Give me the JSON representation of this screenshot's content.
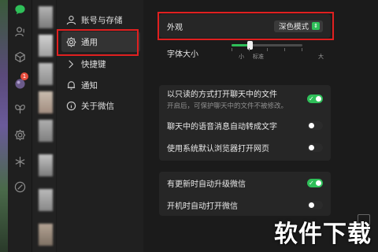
{
  "rail": {
    "badge": "1",
    "icons": [
      "chat-icon",
      "contacts-icon",
      "box-icon",
      "photo-icon",
      "butterfly-icon",
      "settings-gear-icon",
      "sparkle-icon",
      "link-icon"
    ]
  },
  "sidebar": {
    "items": [
      {
        "label": "账号与存储",
        "icon": "user-icon"
      },
      {
        "label": "通用",
        "icon": "gear-icon"
      },
      {
        "label": "快捷键",
        "icon": "keyboard-icon"
      },
      {
        "label": "通知",
        "icon": "bell-icon"
      },
      {
        "label": "关于微信",
        "icon": "info-icon"
      }
    ]
  },
  "main": {
    "appearance": {
      "label": "外观",
      "value": "深色模式"
    },
    "font_size": {
      "label": "字体大小",
      "marks": [
        "小",
        "标准",
        "大"
      ],
      "level": 0.25
    },
    "group1": [
      {
        "title": "以只读的方式打开聊天中的文件",
        "sub": "开启后，可保护聊天中的文件不被修改。",
        "on": true
      },
      {
        "title": "聊天中的语音消息自动转成文字",
        "sub": "",
        "on": false
      },
      {
        "title": "使用系统默认浏览器打开网页",
        "sub": "",
        "on": false
      }
    ],
    "group2": [
      {
        "title": "有更新时自动升级微信",
        "on": true
      },
      {
        "title": "开机时自动打开微信",
        "on": false
      }
    ]
  },
  "watermark": "软件下载",
  "colors": {
    "accent": "#2fbf59",
    "highlight": "#e02020"
  }
}
